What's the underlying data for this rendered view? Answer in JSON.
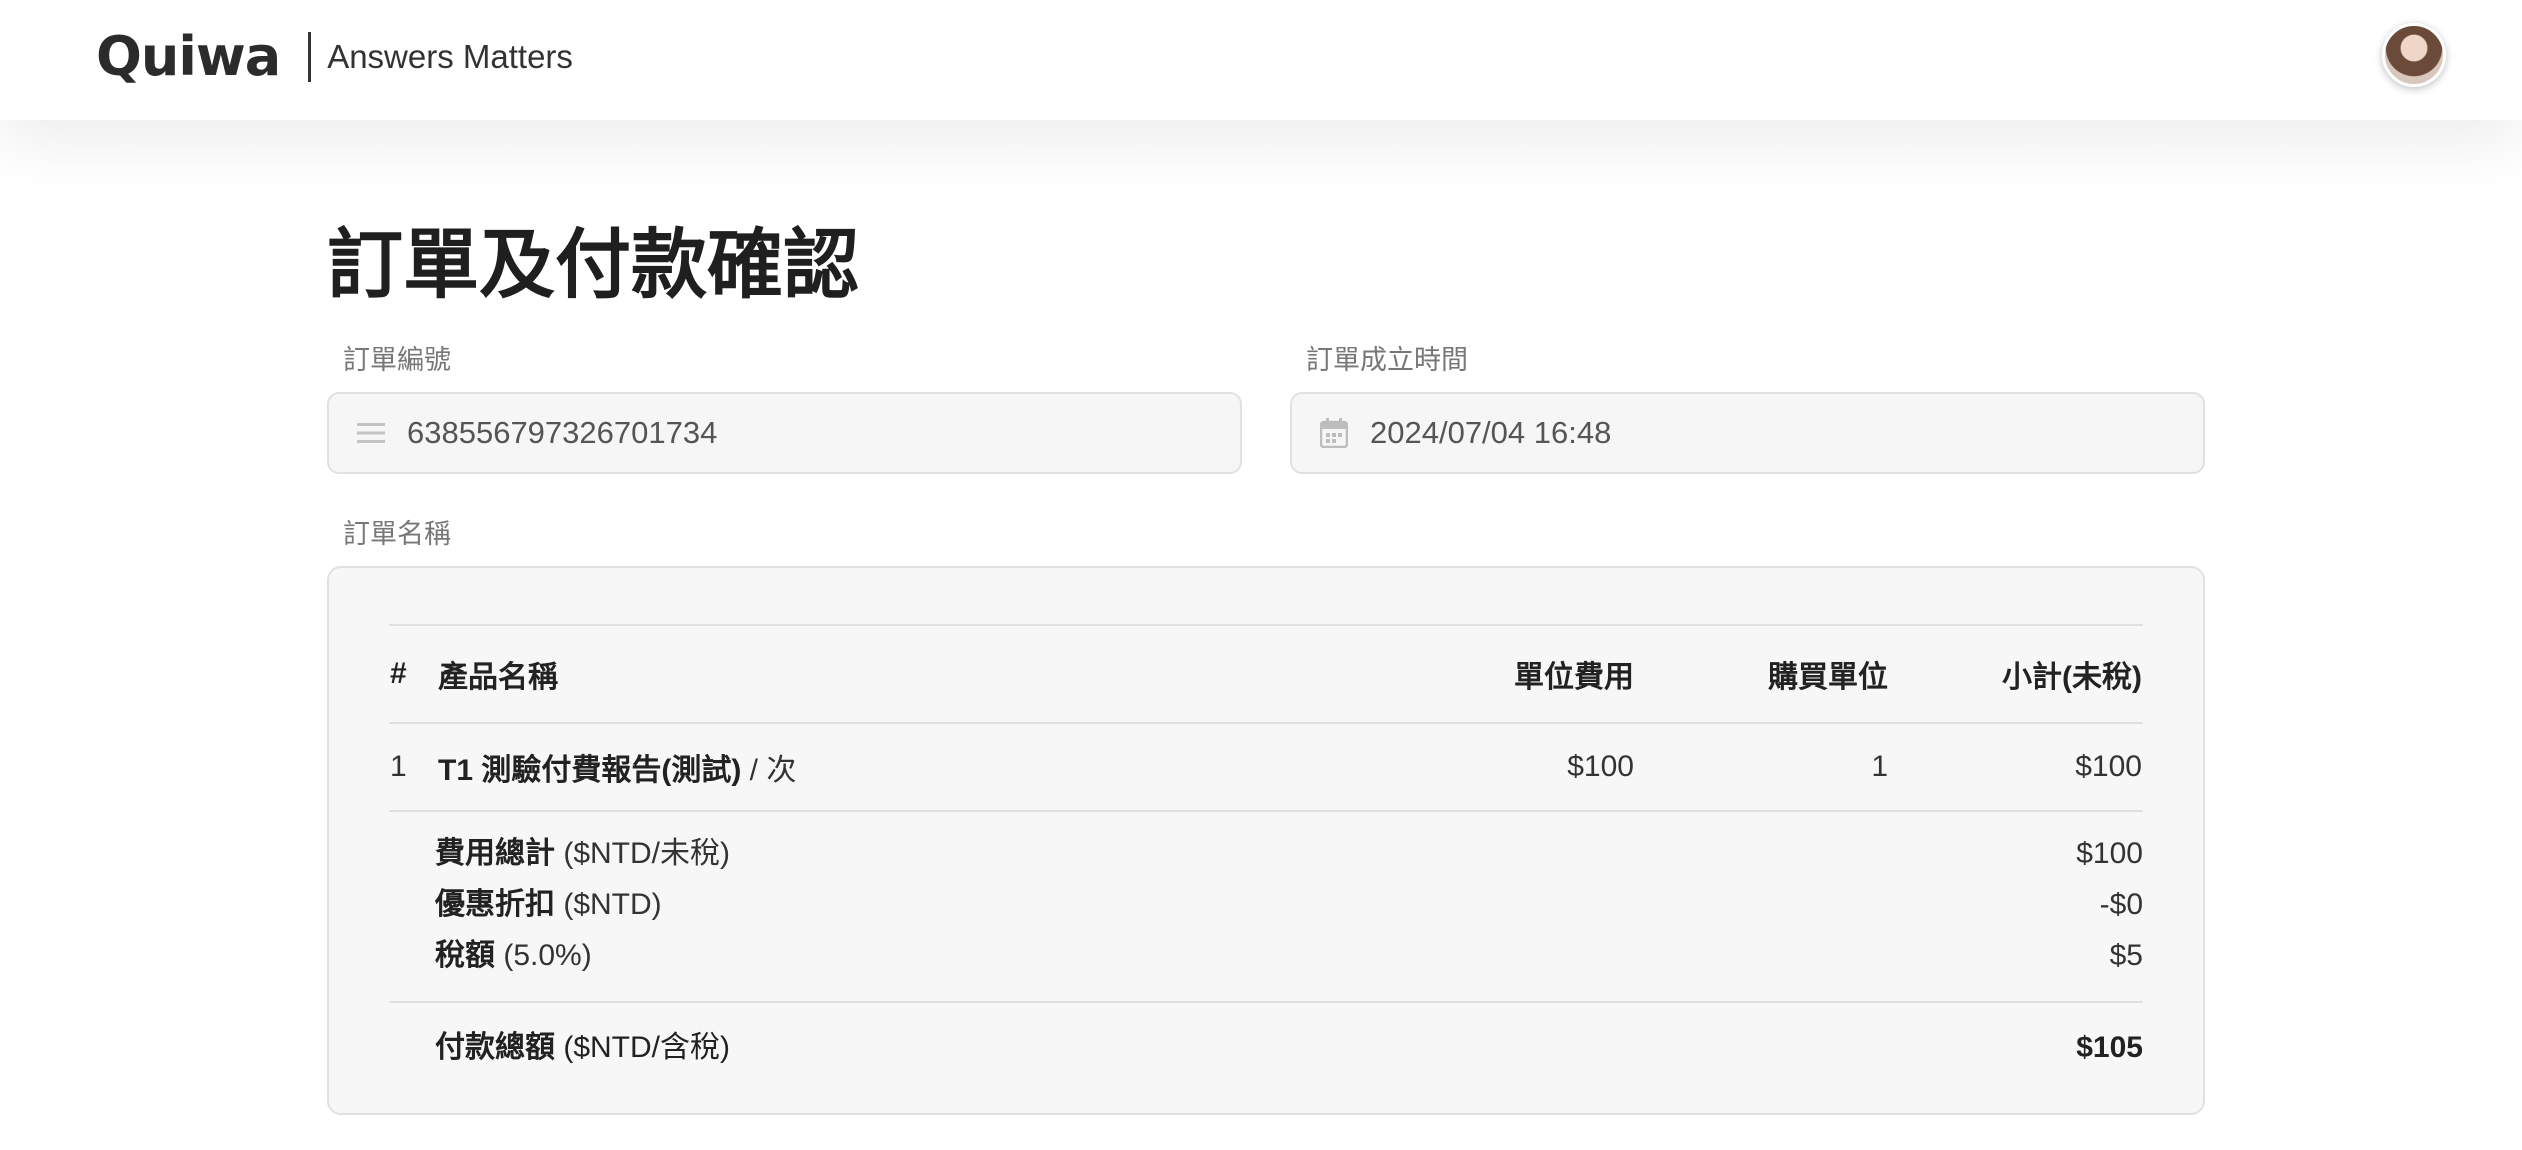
{
  "header": {
    "logo_text": "Quiwa",
    "tagline": "Answers Matters"
  },
  "page": {
    "title": "訂單及付款確認"
  },
  "order_number": {
    "label": "訂單編號",
    "value": "638556797326701734",
    "icon": "list-icon"
  },
  "order_time": {
    "label": "訂單成立時間",
    "value": "2024/07/04 16:48",
    "icon": "calendar-icon"
  },
  "order_name": {
    "label": "訂單名稱"
  },
  "table": {
    "headers": {
      "num": "#",
      "product": "產品名稱",
      "unit_price": "單位費用",
      "quantity": "購買單位",
      "subtotal": "小計(未稅)"
    },
    "rows": [
      {
        "num": "1",
        "product_bold": "T1 測驗付費報告(測試)",
        "product_suffix": " / 次",
        "unit_price": "$100",
        "quantity": "1",
        "subtotal": "$100"
      }
    ]
  },
  "summary": {
    "fee_total": {
      "label": "費用總計",
      "note": " ($NTD/未稅)",
      "value": "$100"
    },
    "discount": {
      "label": "優惠折扣",
      "note": " ($NTD)",
      "value": "-$0"
    },
    "tax": {
      "label": "稅額",
      "note": " (5.0%)",
      "value": "$5"
    },
    "grand_total": {
      "label": "付款總額",
      "note": " ($NTD/含稅)",
      "value": "$105"
    }
  }
}
